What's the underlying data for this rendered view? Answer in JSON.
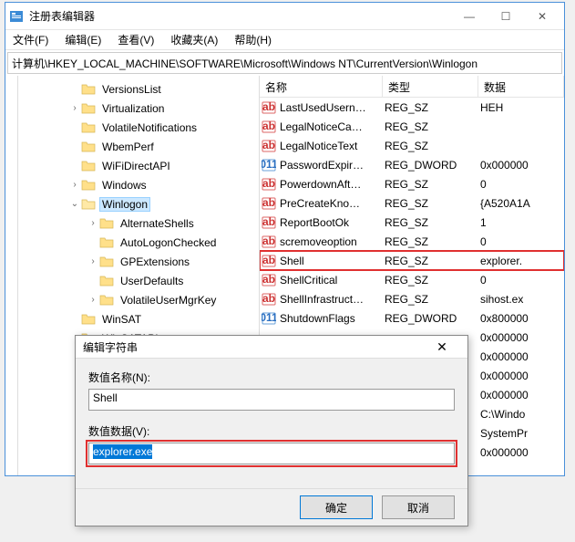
{
  "window": {
    "title": "注册表编辑器",
    "menus": {
      "file": "文件(F)",
      "edit": "编辑(E)",
      "view": "查看(V)",
      "favorites": "收藏夹(A)",
      "help": "帮助(H)"
    },
    "address": "计算机\\HKEY_LOCAL_MACHINE\\SOFTWARE\\Microsoft\\Windows NT\\CurrentVersion\\Winlogon",
    "win_buttons": {
      "min": "—",
      "max": "☐",
      "close": "✕"
    }
  },
  "tree": [
    {
      "label": "VersionsList",
      "depth": 1,
      "twisty": ""
    },
    {
      "label": "Virtualization",
      "depth": 1,
      "twisty": "›"
    },
    {
      "label": "VolatileNotifications",
      "depth": 1,
      "twisty": ""
    },
    {
      "label": "WbemPerf",
      "depth": 1,
      "twisty": ""
    },
    {
      "label": "WiFiDirectAPI",
      "depth": 1,
      "twisty": ""
    },
    {
      "label": "Windows",
      "depth": 1,
      "twisty": "›"
    },
    {
      "label": "Winlogon",
      "depth": 1,
      "twisty": "⌄",
      "selected": true
    },
    {
      "label": "AlternateShells",
      "depth": 2,
      "twisty": "›"
    },
    {
      "label": "AutoLogonChecked",
      "depth": 2,
      "twisty": ""
    },
    {
      "label": "GPExtensions",
      "depth": 2,
      "twisty": "›"
    },
    {
      "label": "UserDefaults",
      "depth": 2,
      "twisty": ""
    },
    {
      "label": "VolatileUserMgrKey",
      "depth": 2,
      "twisty": "›"
    },
    {
      "label": "WinSAT",
      "depth": 1,
      "twisty": ""
    },
    {
      "label": "WinSATAPI",
      "depth": 1,
      "twisty": ""
    }
  ],
  "list": {
    "headers": {
      "name": "名称",
      "type": "类型",
      "data": "数据"
    },
    "rows": [
      {
        "icon": "sz",
        "name": "LastUsedUsern…",
        "type": "REG_SZ",
        "data": "HEH"
      },
      {
        "icon": "sz",
        "name": "LegalNoticeCa…",
        "type": "REG_SZ",
        "data": ""
      },
      {
        "icon": "sz",
        "name": "LegalNoticeText",
        "type": "REG_SZ",
        "data": ""
      },
      {
        "icon": "dw",
        "name": "PasswordExpir…",
        "type": "REG_DWORD",
        "data": "0x000000"
      },
      {
        "icon": "sz",
        "name": "PowerdownAft…",
        "type": "REG_SZ",
        "data": "0"
      },
      {
        "icon": "sz",
        "name": "PreCreateKno…",
        "type": "REG_SZ",
        "data": "{A520A1A"
      },
      {
        "icon": "sz",
        "name": "ReportBootOk",
        "type": "REG_SZ",
        "data": "1"
      },
      {
        "icon": "sz",
        "name": "scremoveoption",
        "type": "REG_SZ",
        "data": "0"
      },
      {
        "icon": "sz",
        "name": "Shell",
        "type": "REG_SZ",
        "data": "explorer.",
        "highlight": true
      },
      {
        "icon": "sz",
        "name": "ShellCritical",
        "type": "REG_SZ",
        "data": "0"
      },
      {
        "icon": "sz",
        "name": "ShellInfrastruct…",
        "type": "REG_SZ",
        "data": "sihost.ex"
      },
      {
        "icon": "dw",
        "name": "ShutdownFlags",
        "type": "REG_DWORD",
        "data": "0x800000"
      },
      {
        "icon": "",
        "name": "",
        "type": "",
        "data": "0x000000"
      },
      {
        "icon": "",
        "name": "",
        "type": "",
        "data": "0x000000"
      },
      {
        "icon": "",
        "name": "",
        "type": "",
        "data": "0x000000"
      },
      {
        "icon": "",
        "name": "",
        "type": "",
        "data": "0x000000"
      },
      {
        "icon": "",
        "name": "",
        "type": "",
        "data": "C:\\Windo"
      },
      {
        "icon": "",
        "name": "",
        "type": "",
        "data": "SystemPr"
      },
      {
        "icon": "",
        "name": "",
        "type": "",
        "data": "0x000000"
      }
    ]
  },
  "dialog": {
    "title": "编辑字符串",
    "name_label": "数值名称(N):",
    "name_value": "Shell",
    "data_label": "数值数据(V):",
    "data_value": "explorer.exe",
    "ok": "确定",
    "cancel": "取消",
    "close": "✕"
  }
}
